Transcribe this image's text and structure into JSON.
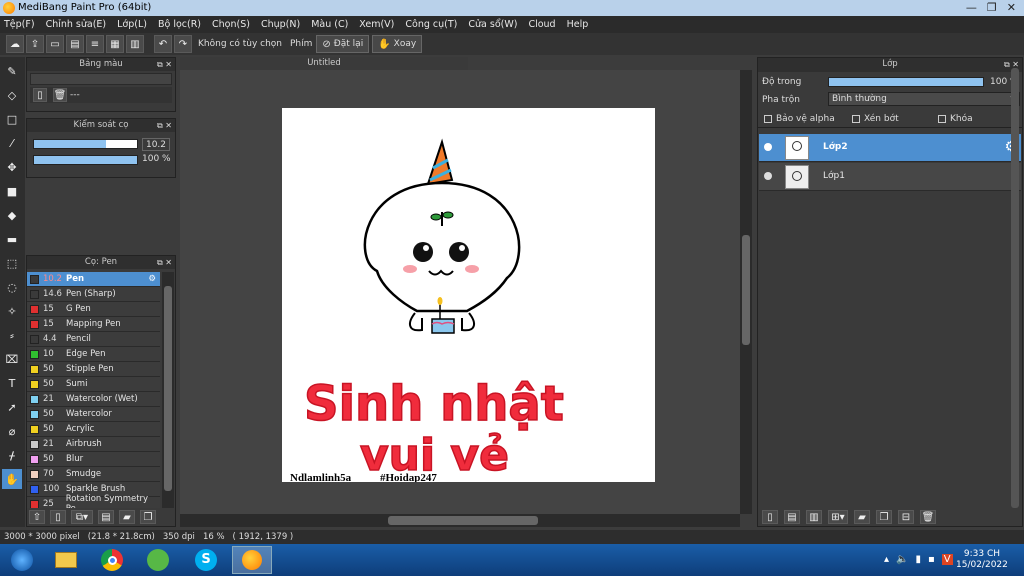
{
  "window": {
    "title": "MediBang Paint Pro (64bit)",
    "min": "—",
    "max": "❐",
    "close": "✕"
  },
  "menu": [
    "Tệp(F)",
    "Chỉnh sửa(E)",
    "Lớp(L)",
    "Bộ lọc(R)",
    "Chọn(S)",
    "Chụp(N)",
    "Màu (C)",
    "Xem(V)",
    "Công cụ(T)",
    "Cửa sổ(W)",
    "Cloud",
    "Help"
  ],
  "toolbar": {
    "option_label": "Không có tùy chọn",
    "key_label": "Phím",
    "reset_label": "Đặt lại",
    "rotate_label": "Xoay"
  },
  "color_panel": {
    "title": "Bảng màu",
    "value": "---"
  },
  "brush_control": {
    "title": "Kiểm soát cọ",
    "size": "10.2",
    "opacity": "100 %",
    "size_fill": 0.7,
    "opacity_fill": 1.0
  },
  "brush_panel": {
    "title": "Cọ: Pen",
    "items": [
      {
        "size": "10.2",
        "name": "Pen",
        "color": "#3a3a3a"
      },
      {
        "size": "14.6",
        "name": "Pen (Sharp)",
        "color": "#3a3a3a"
      },
      {
        "size": "15",
        "name": "G Pen",
        "color": "#e03030"
      },
      {
        "size": "15",
        "name": "Mapping Pen",
        "color": "#e03030"
      },
      {
        "size": "4.4",
        "name": "Pencil",
        "color": "#3a3a3a"
      },
      {
        "size": "10",
        "name": "Edge Pen",
        "color": "#30c030"
      },
      {
        "size": "50",
        "name": "Stipple Pen",
        "color": "#f0d020"
      },
      {
        "size": "50",
        "name": "Sumi",
        "color": "#f0d020"
      },
      {
        "size": "21",
        "name": "Watercolor (Wet)",
        "color": "#7fd0f0"
      },
      {
        "size": "50",
        "name": "Watercolor",
        "color": "#7fd0f0"
      },
      {
        "size": "50",
        "name": "Acrylic",
        "color": "#f0d020"
      },
      {
        "size": "21",
        "name": "Airbrush",
        "color": "#c8c8c8"
      },
      {
        "size": "50",
        "name": "Blur",
        "color": "#f0a0f0"
      },
      {
        "size": "70",
        "name": "Smudge",
        "color": "#f0d0c0"
      },
      {
        "size": "100",
        "name": "Sparkle Brush",
        "color": "#3060f0"
      },
      {
        "size": "25",
        "name": "Rotation Symmetry Pe",
        "color": "#e03030"
      }
    ]
  },
  "canvas": {
    "tab": "Untitled",
    "title_line1": "Sinh nhật",
    "title_line2": "vui vẻ",
    "credit_left": "Ndlamlinh5a",
    "credit_right": "#Hoidap247"
  },
  "layers_panel": {
    "title": "Lớp",
    "opacity_label": "Độ trong",
    "opacity_value": "100 %",
    "opacity_fill": 1.0,
    "blend_label": "Pha trộn",
    "blend_value": "Bình thường",
    "protect_alpha": "Bảo vệ alpha",
    "clipping": "Xén bớt",
    "lock": "Khóa",
    "layers": [
      {
        "name": "Lớp2",
        "selected": true
      },
      {
        "name": "Lớp1",
        "selected": false
      }
    ]
  },
  "status": {
    "size": "3000 * 3000 pixel",
    "physical": "(21.8 * 21.8cm)",
    "dpi": "350 dpi",
    "zoom": "16 %",
    "coords": "( 1912, 1379 )"
  },
  "taskbar": {
    "time": "9:33 CH",
    "date": "15/02/2022"
  }
}
